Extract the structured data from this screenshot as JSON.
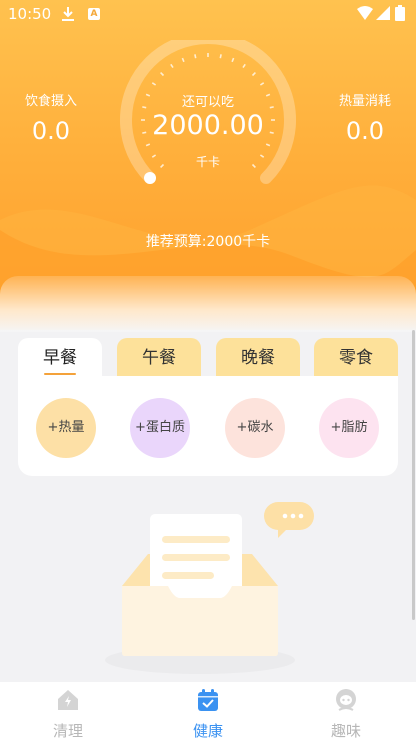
{
  "status_bar": {
    "time": "10:50",
    "a_badge": "A"
  },
  "header": {
    "intake_label": "饮食摄入",
    "intake_value": "0.0",
    "remaining_label": "还可以吃",
    "remaining_value": "2000.00",
    "remaining_unit": "千卡",
    "burn_label": "热量消耗",
    "burn_value": "0.0",
    "budget_text": "推荐预算:2000千卡",
    "progress_fraction": 0.0
  },
  "meal_tabs": [
    {
      "label": "早餐",
      "active": true
    },
    {
      "label": "午餐",
      "active": false
    },
    {
      "label": "晚餐",
      "active": false
    },
    {
      "label": "零食",
      "active": false
    }
  ],
  "nutrients": [
    {
      "label": "+热量",
      "color": "#fde0a6"
    },
    {
      "label": "+蛋白质",
      "color": "#ead6fb"
    },
    {
      "label": "+碳水",
      "color": "#fde3dc"
    },
    {
      "label": "+脂肪",
      "color": "#fde3f0"
    }
  ],
  "bottom_nav": [
    {
      "label": "清理",
      "icon": "home-clean-icon",
      "active": false
    },
    {
      "label": "健康",
      "icon": "calendar-check-icon",
      "active": true
    },
    {
      "label": "趣味",
      "icon": "face-icon",
      "active": false
    }
  ],
  "colors": {
    "header_top": "#ffc24f",
    "header_bottom": "#ff9d2a",
    "accent": "#f4a23a",
    "nav_active": "#3b92f1",
    "tab_inactive": "#fde19a"
  }
}
